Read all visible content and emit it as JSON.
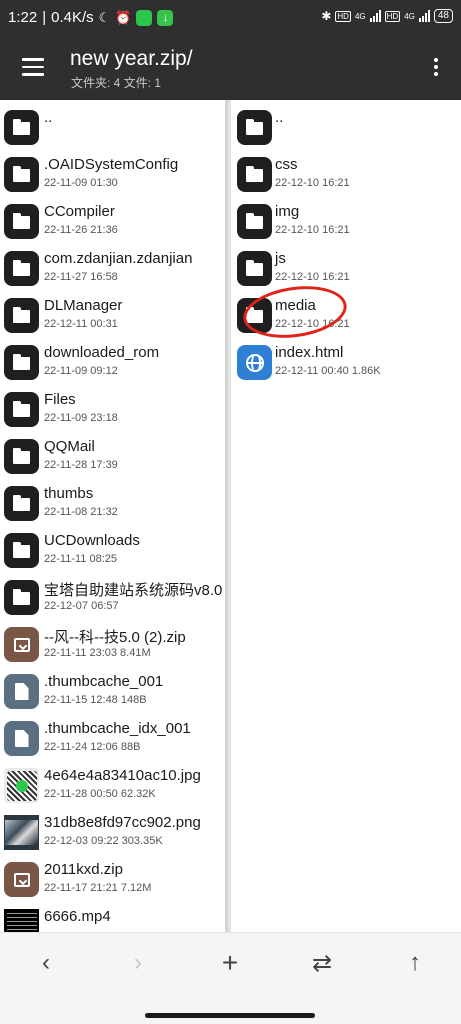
{
  "status": {
    "time": "1:22",
    "speed": "0.4K/s",
    "network1": "4G",
    "network2": "4G",
    "hd": "HD",
    "battery": "48"
  },
  "appbar": {
    "title": "new year.zip/",
    "subtitle": "文件夹: 4   文件: 1"
  },
  "left_pane": [
    {
      "name": "..",
      "meta": "",
      "type": "folder"
    },
    {
      "name": ".OAIDSystemConfig",
      "meta": "22-11-09 01:30",
      "type": "folder"
    },
    {
      "name": "CCompiler",
      "meta": "22-11-26 21:36",
      "type": "folder"
    },
    {
      "name": "com.zdanjian.zdanjian",
      "meta": "22-11-27 16:58",
      "type": "folder"
    },
    {
      "name": "DLManager",
      "meta": "22-12-11 00:31",
      "type": "folder"
    },
    {
      "name": "downloaded_rom",
      "meta": "22-11-09 09:12",
      "type": "folder"
    },
    {
      "name": "Files",
      "meta": "22-11-09 23:18",
      "type": "folder"
    },
    {
      "name": "QQMail",
      "meta": "22-11-28 17:39",
      "type": "folder"
    },
    {
      "name": "thumbs",
      "meta": "22-11-08 21:32",
      "type": "folder"
    },
    {
      "name": "UCDownloads",
      "meta": "22-11-11 08:25",
      "type": "folder"
    },
    {
      "name": "宝塔自助建站系统源码v8.0",
      "meta": "22-12-07 06:57",
      "type": "folder"
    },
    {
      "name": "--风--科--技5.0 (2).zip",
      "meta": "22-11-11 23:03  8.41M",
      "type": "zip"
    },
    {
      "name": ".thumbcache_001",
      "meta": "22-11-15 12:48  148B",
      "type": "doc"
    },
    {
      "name": ".thumbcache_idx_001",
      "meta": "22-11-24 12:06  88B",
      "type": "doc"
    },
    {
      "name": "4e64e4a83410ac10.jpg",
      "meta": "22-11-28 00:50  62.32K",
      "type": "img1"
    },
    {
      "name": "31db8e8fd97cc902.png",
      "meta": "22-12-03 09:22  303.35K",
      "type": "img2"
    },
    {
      "name": "2011kxd.zip",
      "meta": "22-11-17 21:21  7.12M",
      "type": "zip"
    },
    {
      "name": "6666.mp4",
      "meta": "",
      "type": "vid"
    }
  ],
  "right_pane": [
    {
      "name": "..",
      "meta": "",
      "type": "folder"
    },
    {
      "name": "css",
      "meta": "22-12-10 16:21",
      "type": "folder"
    },
    {
      "name": "img",
      "meta": "22-12-10 16:21",
      "type": "folder"
    },
    {
      "name": "js",
      "meta": "22-12-10 16:21",
      "type": "folder"
    },
    {
      "name": "media",
      "meta": "22-12-10 16:21",
      "type": "folder"
    },
    {
      "name": "index.html",
      "meta": "22-12-11 00:40  1.86K",
      "type": "web"
    }
  ],
  "toolbar": {
    "back": "‹",
    "forward": "›",
    "add": "+",
    "swap": "⇄",
    "up": "↑"
  },
  "icons": {
    "menu": "menu-icon",
    "more": "more-vert-icon",
    "folder": "folder-icon",
    "zip": "archive-icon",
    "doc": "document-icon",
    "web": "globe-icon"
  }
}
